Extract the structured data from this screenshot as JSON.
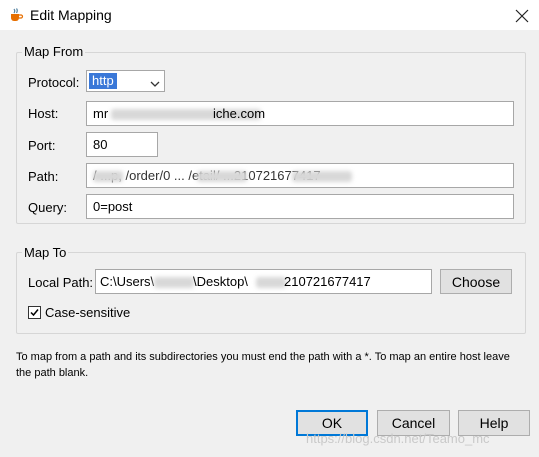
{
  "window": {
    "title": "Edit Mapping",
    "close_glyph": "✕"
  },
  "map_from": {
    "legend": "Map From",
    "protocol_label": "Protocol:",
    "protocol_value": "http",
    "host_label": "Host:",
    "host_value_start": "mr",
    "host_value_end": "iche.com",
    "port_label": "Port:",
    "port_value": "80",
    "path_label": "Path:",
    "path_value_visible": "/ ...p,  /order/0  ...  /etail/  ...210721677417",
    "query_label": "Query:",
    "query_value": "0=post"
  },
  "map_to": {
    "legend": "Map To",
    "local_path_label": "Local Path:",
    "local_path_part1": "C:\\Users\\",
    "local_path_part2": "\\Desktop\\",
    "local_path_part3": "210721677417",
    "choose_label": "Choose",
    "case_sensitive_label": "Case-sensitive",
    "case_sensitive_checked": true
  },
  "note": "To map from a path and its subdirectories you must end the path with a *. To map an entire host leave the path blank.",
  "buttons": {
    "ok": "OK",
    "cancel": "Cancel",
    "help": "Help"
  },
  "watermark": "https://blog.csdn.net/Teamo_mc",
  "icons": [
    "java-cup-icon",
    "close-icon",
    "chevron-down-icon",
    "checkmark-icon"
  ]
}
